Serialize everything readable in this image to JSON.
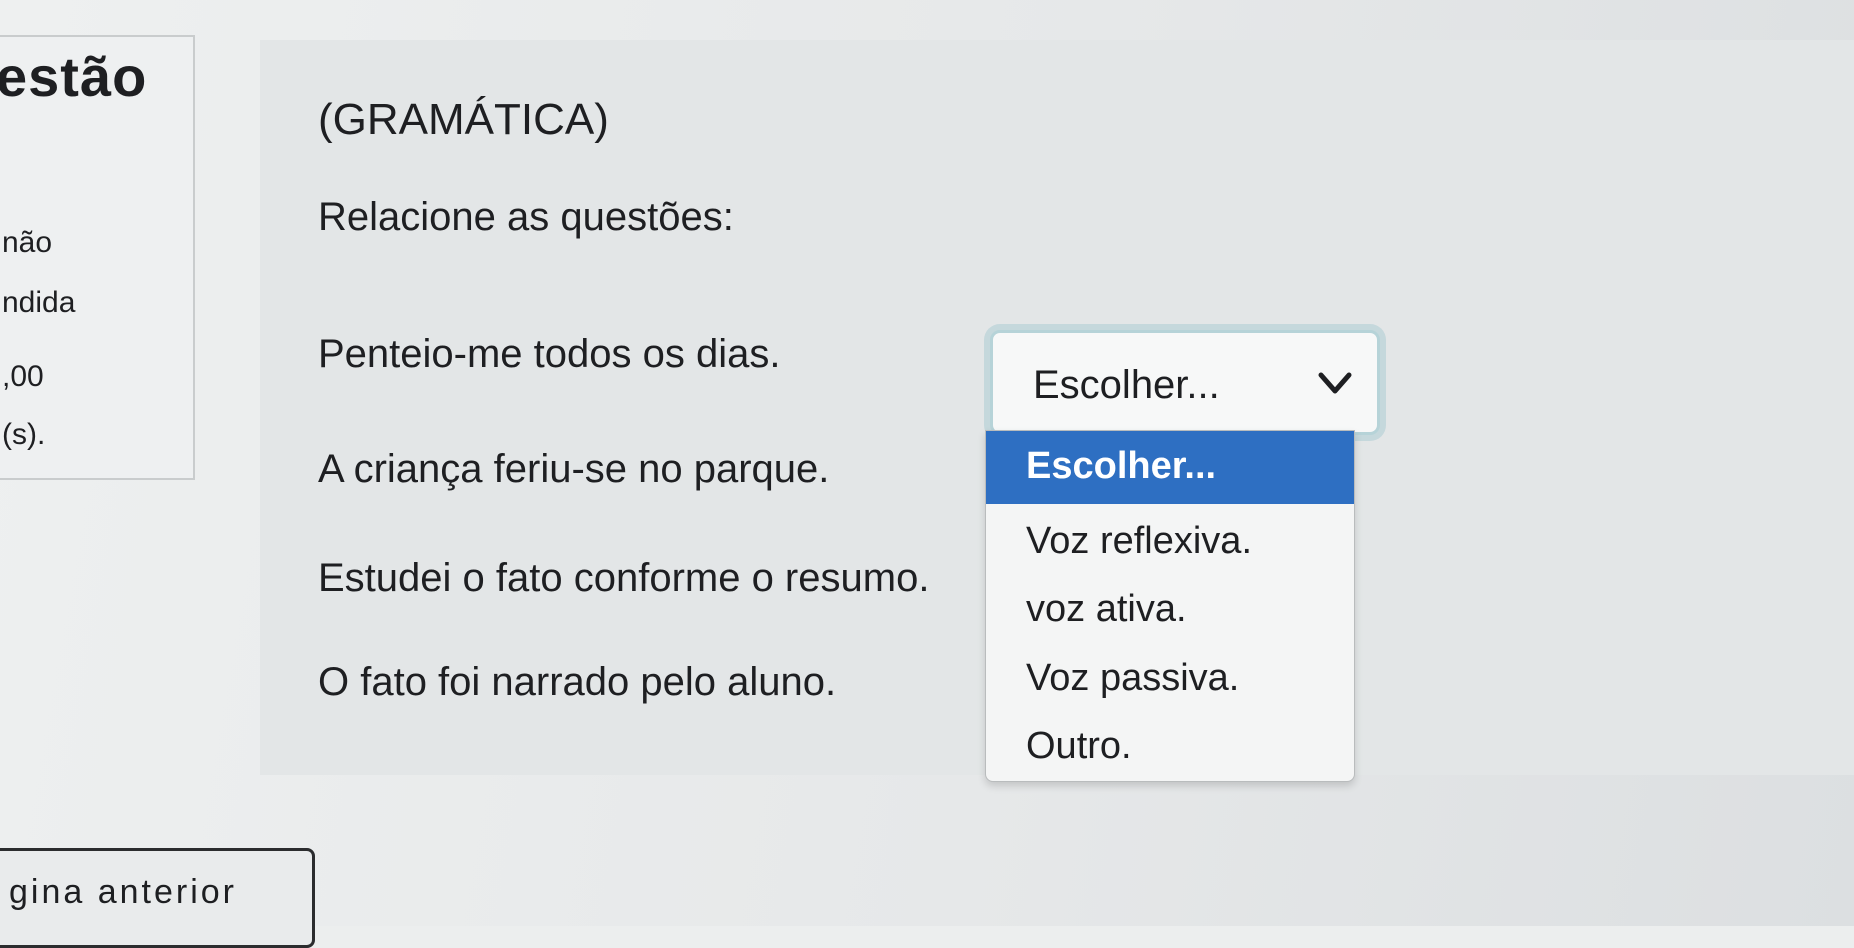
{
  "sidebar": {
    "title": "estão",
    "status_line1": "não",
    "status_line2": "ndida",
    "grade": ",00",
    "points_suffix": "(s)."
  },
  "question": {
    "heading": "(GRAMÁTICA)",
    "intro": "Relacione as questões:",
    "rows": [
      {
        "text": "Penteio-me todos os dias."
      },
      {
        "text": "A criança feriu-se no parque."
      },
      {
        "text": "Estudei o fato conforme o resumo."
      },
      {
        "text": "O fato foi narrado pelo aluno."
      }
    ]
  },
  "select": {
    "value": "Escolher...",
    "arrow_icon": "chevron-down-icon",
    "options": [
      {
        "label": "Escolher...",
        "selected": true
      },
      {
        "label": "Voz reflexiva.",
        "selected": false
      },
      {
        "label": "voz ativa.",
        "selected": false
      },
      {
        "label": "Voz passiva.",
        "selected": false
      },
      {
        "label": "Outro.",
        "selected": false
      }
    ],
    "highlight_color": "#2e6fc2"
  },
  "navigation": {
    "prev_label": "gina anterior"
  }
}
